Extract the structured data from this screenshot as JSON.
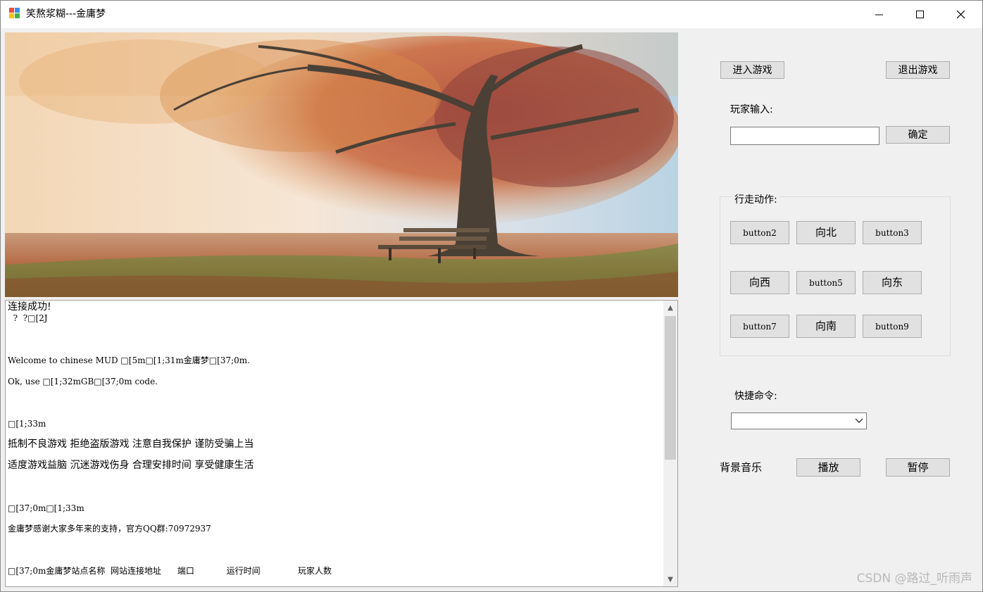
{
  "window": {
    "title": "笑熬浆糊---金庸梦"
  },
  "console": {
    "lines": [
      "连接成功!",
      "  ?  ?□[2J",
      "Welcome to chinese MUD □[5m□[1;31m金庸梦□[37;0m.",
      "Ok, use □[1;32mGB□[37;0m code.",
      "□[1;33m",
      "抵制不良游戏 拒绝盗版游戏 注意自我保护 谨防受骗上当",
      "适度游戏益脑 沉迷游戏伤身 合理安排时间 享受健康生活",
      "□[37;0m□[1;33m",
      "金庸梦感谢大家多年来的支持，官方QQ群:70972937",
      "□[37;0m金庸梦站点名称  网站连接地址      端口            运行时间              玩家人数"
    ]
  },
  "controls": {
    "enter_game": "进入游戏",
    "exit_game": "退出游戏",
    "player_input_label": "玩家输入:",
    "player_input_value": "",
    "confirm": "确定",
    "walk_group_title": "行走动作:",
    "walk_buttons": [
      "button2",
      "向北",
      "button3",
      "向西",
      "button5",
      "向东",
      "button7",
      "向南",
      "button9"
    ],
    "shortcut_label": "快捷命令:",
    "shortcut_value": "",
    "music_label": "背景音乐",
    "play": "播放",
    "pause": "暂停"
  },
  "watermark": "CSDN @路过_听雨声"
}
